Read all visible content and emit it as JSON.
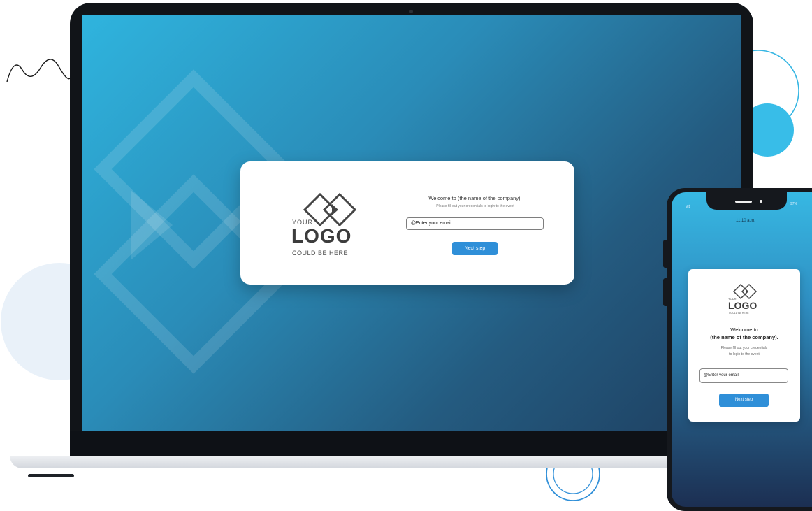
{
  "desktop": {
    "logo": {
      "top": "YOUR",
      "main": "LOGO",
      "sub": "COULD BE HERE"
    },
    "welcome": "Welcome to (the name of the company).",
    "instruction": "Please fill out your credentials to login to the event",
    "email_field": "@Enter your email",
    "next_button": "Next step"
  },
  "mobile": {
    "status_time": "11:10 a.m.",
    "signal": "atl",
    "battery": "97%",
    "logo": {
      "top": "YOUR",
      "main": "LOGO",
      "sub": "COULD BE HERE"
    },
    "welcome_line1": "Welcome to",
    "welcome_line2": "(the name of the company).",
    "instruction_line1": "Please fill out your credentials",
    "instruction_line2": "to login to the event",
    "email_field": "@Enter your email",
    "next_button": "Next step"
  },
  "colors": {
    "accent": "#2f8fd8",
    "screen_top": "#2fb4de",
    "screen_bottom": "#1e3e5f"
  }
}
